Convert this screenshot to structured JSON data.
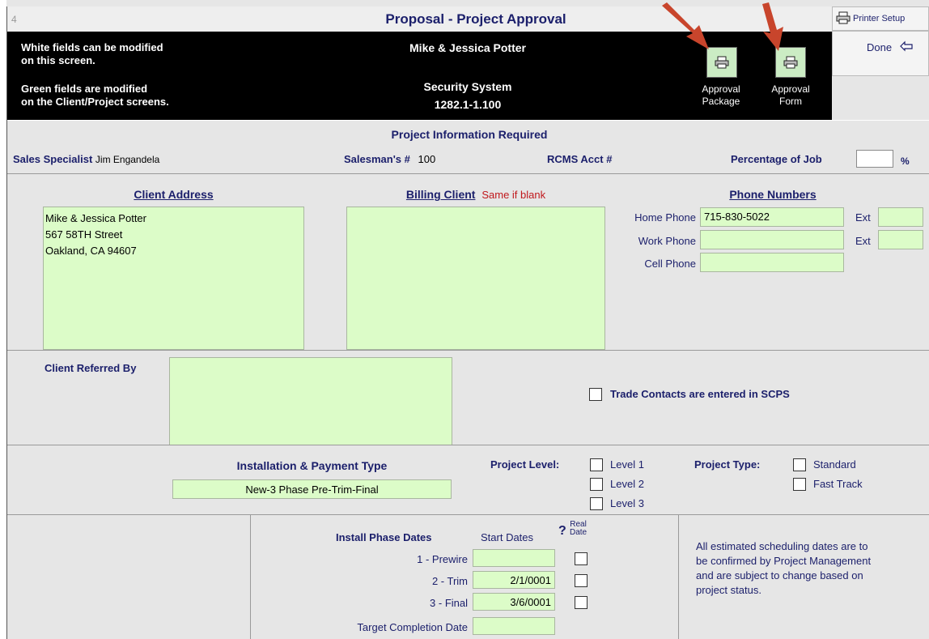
{
  "titlebar": {
    "num": "4",
    "title": "Proposal - Project Approval",
    "printer_setup": "Printer Setup"
  },
  "header": {
    "note1": [
      "White fields can be modified",
      "on this  screen."
    ],
    "note2": [
      "Green fields are modified",
      "on the Client/Project  screens."
    ],
    "client_name": "Mike & Jessica Potter",
    "project_name": "Security System",
    "project_num": "1282.1-1.100",
    "approval_package": [
      "Approval",
      "Package"
    ],
    "approval_form": [
      "Approval",
      "Form"
    ],
    "done": "Done"
  },
  "project_info": {
    "heading": "Project Information Required",
    "sales_specialist_label": "Sales Specialist",
    "sales_specialist": "Jim Engandela",
    "salesman_label": "Salesman's #",
    "salesman_num": "100",
    "rcms_label": "RCMS Acct #",
    "percentage_label": "Percentage of Job",
    "percentage_value": "",
    "percent_sign": "%"
  },
  "address": {
    "client_heading": "Client Address",
    "client_lines": [
      "Mike & Jessica Potter",
      "567 58TH Street",
      "Oakland, CA 94607"
    ],
    "billing_heading": "Billing Client",
    "billing_note": "Same if blank",
    "phone_heading": "Phone Numbers",
    "home_label": "Home Phone",
    "home_value": "715-830-5022",
    "work_label": "Work Phone",
    "work_value": "",
    "cell_label": "Cell Phone",
    "cell_value": "",
    "ext_label": "Ext"
  },
  "referral": {
    "label": "Client Referred By",
    "value": "",
    "trade_label": "Trade Contacts are entered in SCPS"
  },
  "installation": {
    "heading": "Installation & Payment Type",
    "value": "New-3 Phase  Pre-Trim-Final",
    "level_label": "Project Level:",
    "levels": [
      "Level 1",
      "Level 2",
      "Level 3"
    ],
    "type_label": "Project Type:",
    "types": [
      "Standard",
      "Fast Track"
    ]
  },
  "phases": {
    "heading": "Install Phase Dates",
    "start_label": "Start Dates",
    "real_label": [
      "Real",
      "Date"
    ],
    "rows": [
      {
        "label": "1 - Prewire",
        "date": ""
      },
      {
        "label": "2 - Trim",
        "date": "2/1/0001"
      },
      {
        "label": "3 - Final",
        "date": "3/6/0001"
      }
    ],
    "target_label": "Target Completion Date",
    "target_value": "",
    "note": [
      "All estimated scheduling dates are to",
      "be confirmed by Project Management",
      "and are subject to change based on",
      "project status."
    ]
  },
  "colors": {
    "field_green": "#dcfcc8",
    "header_black": "#000000",
    "title_navy": "#1b1f6b",
    "arrow_red": "#c8452c",
    "note_red": "#c0181c"
  }
}
